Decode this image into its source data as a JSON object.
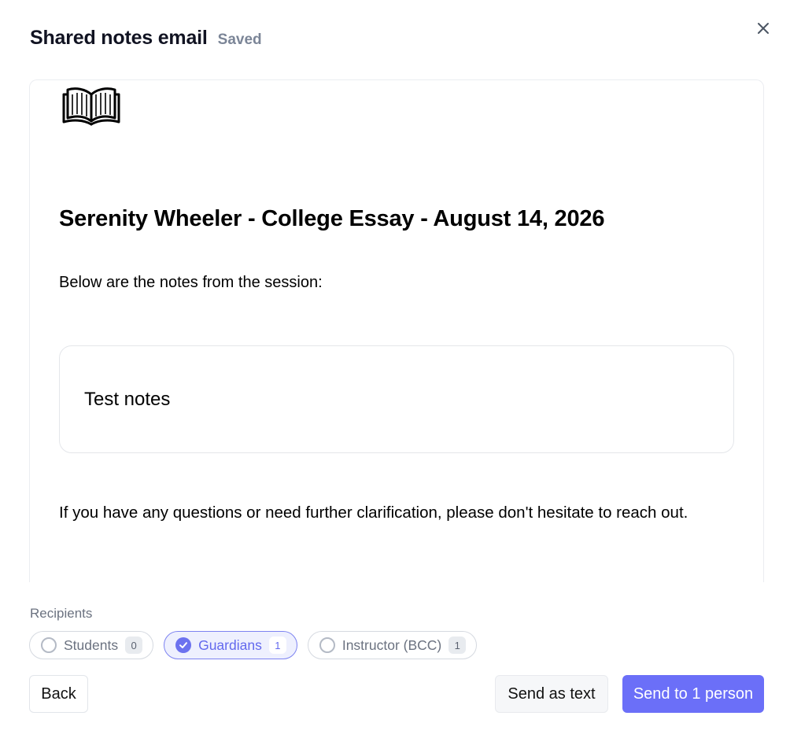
{
  "header": {
    "title": "Shared notes email",
    "status": "Saved",
    "close_icon": "close-icon"
  },
  "email": {
    "logo_icon": "open-book-icon",
    "heading": "Serenity Wheeler - College Essay - August 14, 2026",
    "intro": "Below are the notes from the session:",
    "notes": "Test notes",
    "outro": "If you have any questions or need further clarification, please don't hesitate to reach out."
  },
  "recipients": {
    "label": "Recipients",
    "options": [
      {
        "label": "Students",
        "count": "0",
        "selected": false
      },
      {
        "label": "Guardians",
        "count": "1",
        "selected": true
      },
      {
        "label": "Instructor (BCC)",
        "count": "1",
        "selected": false
      }
    ]
  },
  "footer": {
    "back_label": "Back",
    "send_text_label": "Send as text",
    "send_label": "Send to 1 person"
  },
  "colors": {
    "accent": "#6b6ff8",
    "selected_chip_bg": "#eef0fe",
    "muted_text": "#6b7280"
  }
}
